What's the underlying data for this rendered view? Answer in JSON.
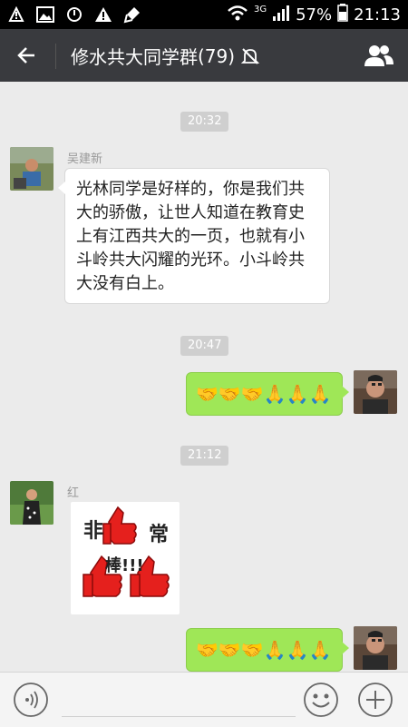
{
  "status_bar": {
    "network": "3G",
    "battery": "57%",
    "time": "21:13"
  },
  "header": {
    "title": "修水共大同学群",
    "member_count": "(79)"
  },
  "messages": [
    {
      "time": "20:32"
    },
    {
      "sender": "吴建新",
      "text": "光林同学是好样的，你是我们共大的骄傲，让世人知道在教育史上有江西共大的一页，也就有小斗岭共大闪耀的光环。小斗岭共大没有白上。"
    },
    {
      "time": "20:47"
    },
    {
      "self_message": "🤝🤝🤝🙏🙏🙏"
    },
    {
      "time": "21:12"
    },
    {
      "sender": "红",
      "sticker_text": [
        "非",
        "常",
        "棒!!!"
      ]
    },
    {
      "self_message": "🤝🤝🤝🙏🙏🙏"
    }
  ],
  "colors": {
    "nav_bg": "#393a3e",
    "chat_bg": "#ebebeb",
    "self_bubble": "#9fe757"
  }
}
